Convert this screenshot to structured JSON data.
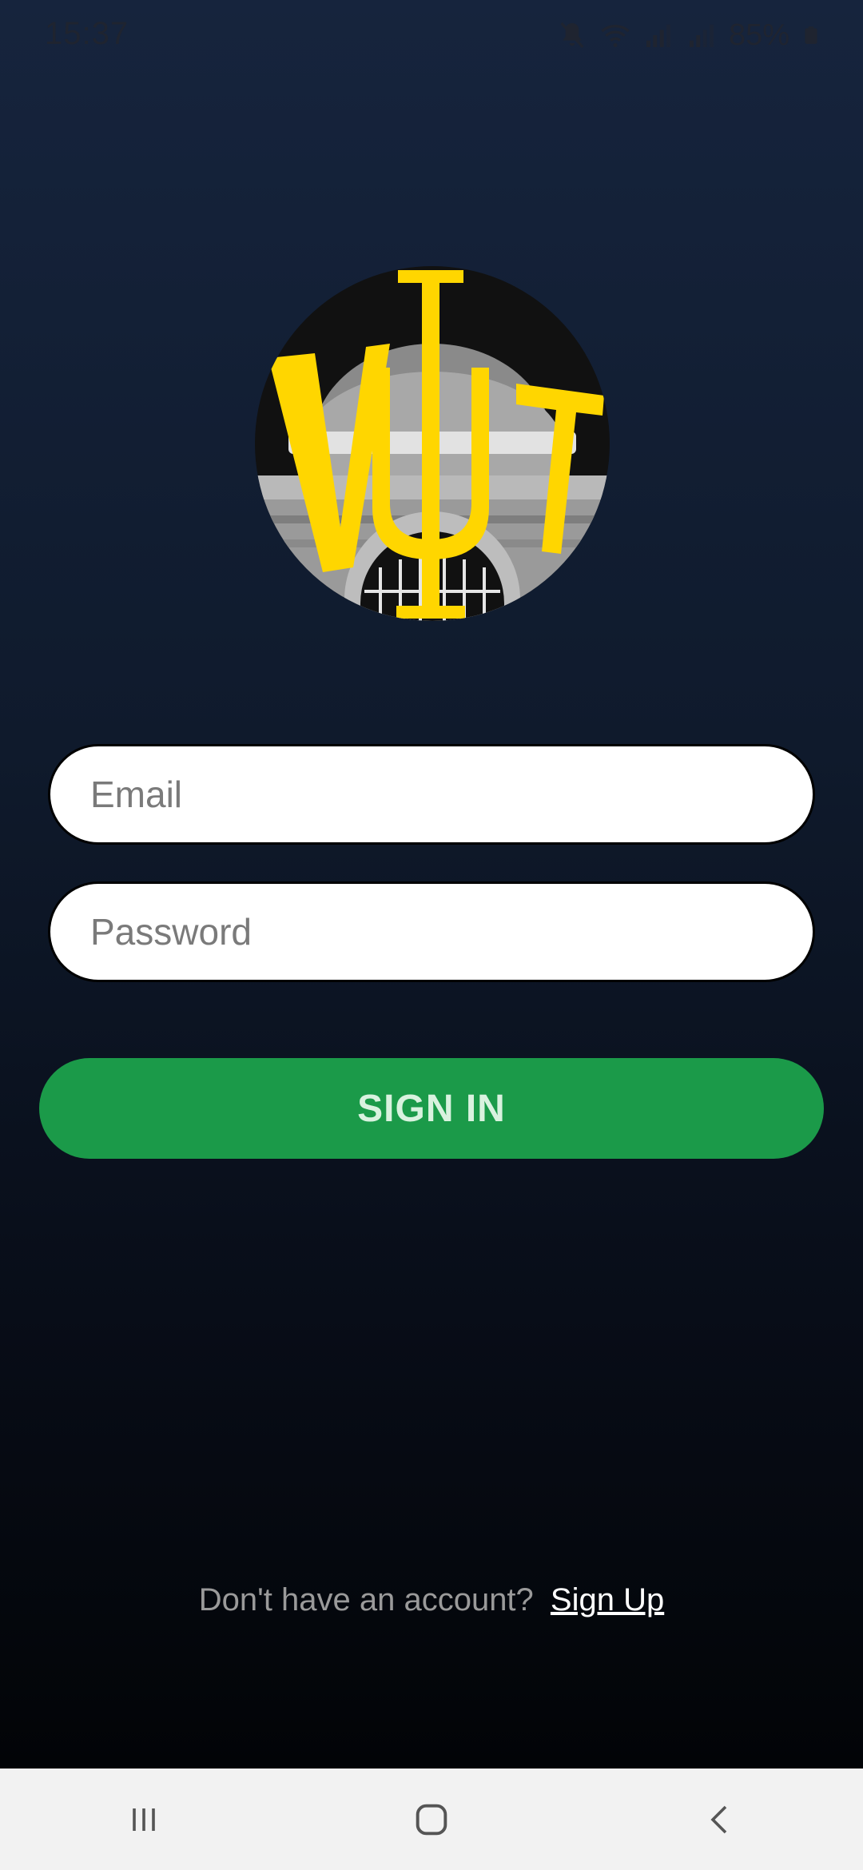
{
  "status_bar": {
    "time": "15:37",
    "battery": "85%",
    "icons": [
      "mute-icon",
      "wifi-icon",
      "signal-icon",
      "signal-icon",
      "battery-icon"
    ]
  },
  "logo": {
    "text": "VJT",
    "colors": {
      "letters": "#FFD600",
      "background": "#111111"
    }
  },
  "form": {
    "email_placeholder": "Email",
    "email_value": "",
    "password_placeholder": "Password",
    "password_value": "",
    "sign_in_label": "SIGN IN"
  },
  "footer": {
    "prompt": "Don't have an account?",
    "signup_label": "Sign Up"
  },
  "nav_bar": {
    "buttons": [
      "recent-apps-icon",
      "home-icon",
      "back-icon"
    ]
  },
  "colors": {
    "accent": "#1B9A49",
    "background_top": "#16243D",
    "background_bottom": "#010203"
  }
}
